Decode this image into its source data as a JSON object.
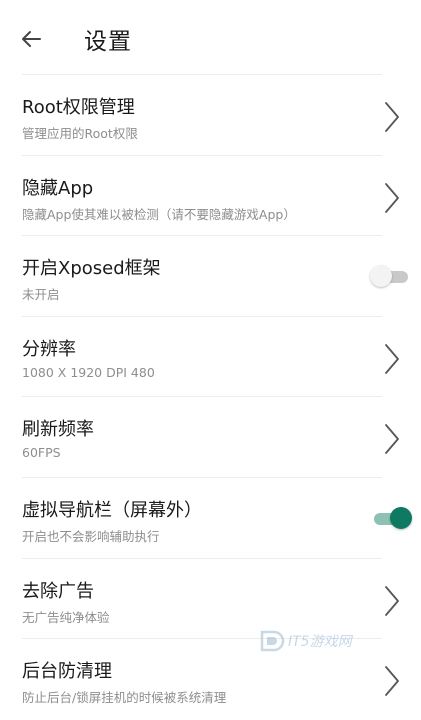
{
  "header": {
    "title": "设置",
    "back_icon": "arrow-left-icon"
  },
  "settings": [
    {
      "title": "Root权限管理",
      "subtitle": "管理应用的Root权限",
      "control": "chevron"
    },
    {
      "title": "隐藏App",
      "subtitle": "隐藏App使其难以被检测（请不要隐藏游戏App）",
      "control": "chevron"
    },
    {
      "title": "开启Xposed框架",
      "subtitle": "未开启",
      "control": "toggle",
      "toggle_state": "off"
    },
    {
      "title": "分辨率",
      "subtitle": "1080 X 1920 DPI 480",
      "control": "chevron"
    },
    {
      "title": "刷新频率",
      "subtitle": "60FPS",
      "control": "chevron"
    },
    {
      "title": "虚拟导航栏（屏幕外）",
      "subtitle": "开启也不会影响辅助执行",
      "control": "toggle",
      "toggle_state": "on"
    },
    {
      "title": "去除广告",
      "subtitle": "无广告纯净体验",
      "control": "chevron"
    },
    {
      "title": "后台防清理",
      "subtitle": "防止后台/锁屏挂机的时候被系统清理",
      "control": "chevron"
    }
  ],
  "watermark": {
    "text": "IT5游戏网"
  },
  "colors": {
    "accent": "#0f7a62",
    "accent_track": "#8fc0b4",
    "subtitle": "#8e8e8e",
    "divider": "#ececec"
  }
}
